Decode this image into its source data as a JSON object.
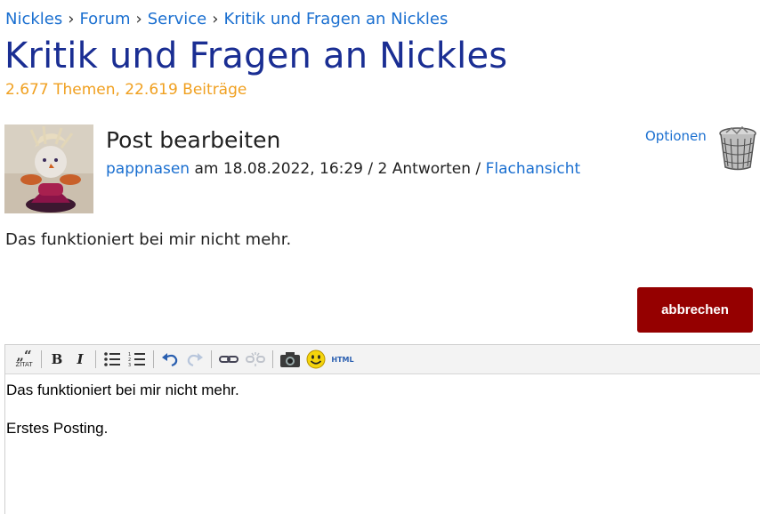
{
  "breadcrumb": {
    "items": [
      "Nickles",
      "Forum",
      "Service",
      "Kritik und Fragen an Nickles"
    ],
    "separator": "›"
  },
  "forum": {
    "title": "Kritik und Fragen an Nickles",
    "stats": "2.677 Themen, 22.619 Beiträge"
  },
  "post": {
    "title": "Post bearbeiten",
    "author": "pappnasen",
    "meta_text": "am 18.08.2022, 16:29 / 2 Antworten /",
    "view_link": "Flachansicht",
    "options_label": "Optionen",
    "body": "Das funktioniert bei mir nicht mehr."
  },
  "actions": {
    "cancel_label": "abbrechen"
  },
  "editor": {
    "toolbar": {
      "quote_label": "ZITAT",
      "bold_label": "B",
      "italic_label": "I",
      "html_label": "HTML"
    },
    "content": [
      "Das funktioniert bei mir nicht mehr.",
      "Erstes Posting."
    ]
  },
  "colors": {
    "link": "#1a6fd0",
    "title": "#1a2e93",
    "stats": "#f0a020",
    "cancel_button": "#950000"
  },
  "icons": [
    "quote-icon",
    "bold-icon",
    "italic-icon",
    "bullet-list-icon",
    "numbered-list-icon",
    "undo-icon",
    "redo-icon",
    "link-icon",
    "unlink-icon",
    "camera-icon",
    "smiley-icon",
    "html-icon",
    "trash-icon"
  ]
}
